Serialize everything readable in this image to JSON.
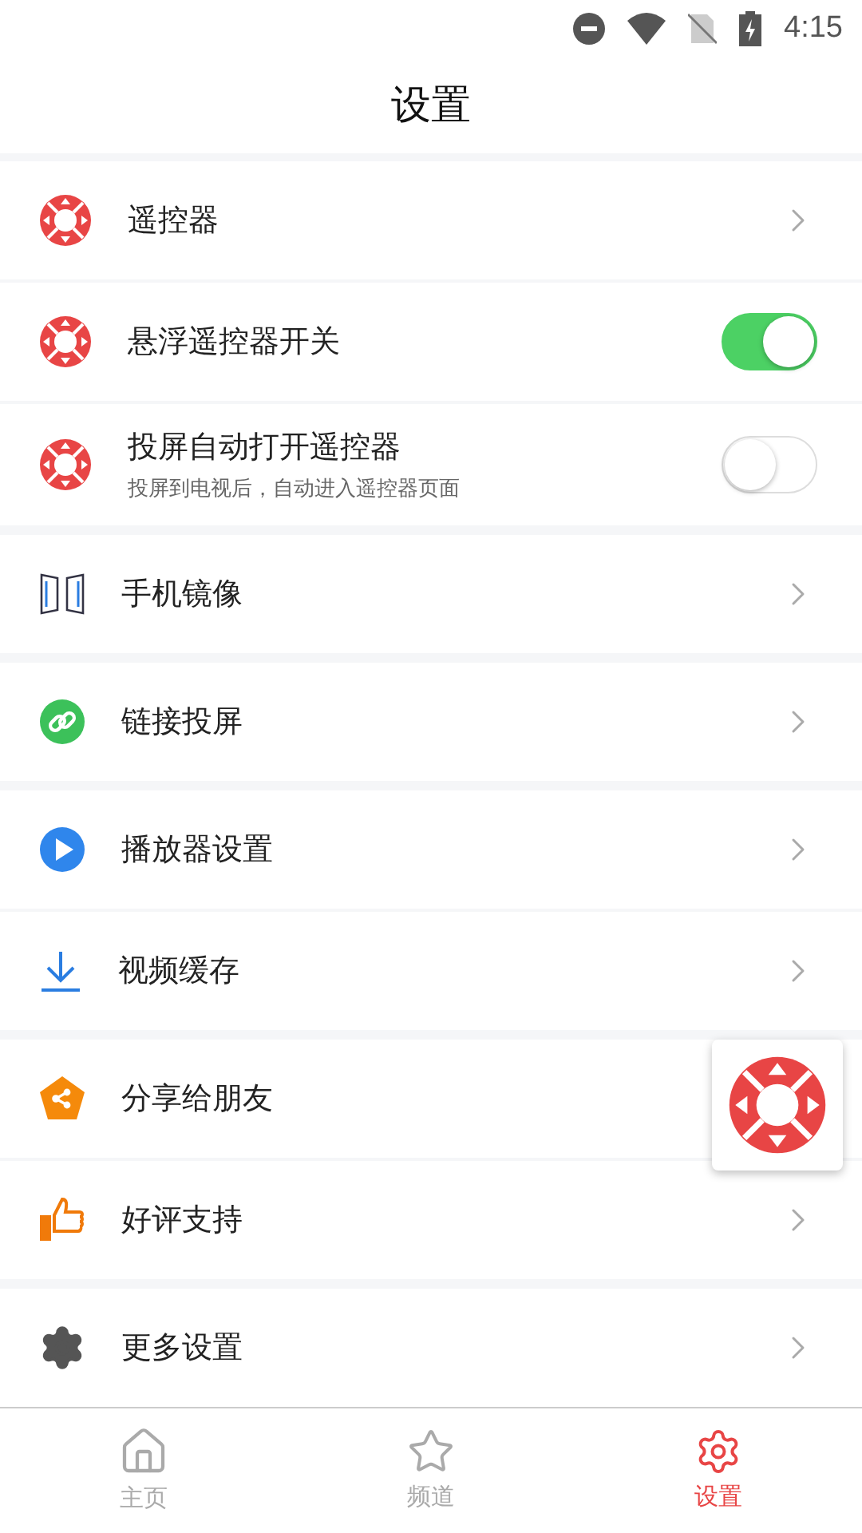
{
  "status_bar": {
    "time": "4:15"
  },
  "header": {
    "title": "设置"
  },
  "groups": [
    {
      "items": [
        {
          "kind": "link",
          "label": "遥控器"
        },
        {
          "kind": "toggle",
          "label": "悬浮遥控器开关",
          "on": true
        },
        {
          "kind": "toggle",
          "label": "投屏自动打开遥控器",
          "subtitle": "投屏到电视后，自动进入遥控器页面",
          "on": false
        }
      ]
    },
    {
      "items": [
        {
          "kind": "link",
          "label": "手机镜像"
        }
      ]
    },
    {
      "items": [
        {
          "kind": "link",
          "label": "链接投屏"
        }
      ]
    },
    {
      "items": [
        {
          "kind": "link",
          "label": "播放器设置"
        },
        {
          "kind": "link",
          "label": "视频缓存"
        }
      ]
    },
    {
      "items": [
        {
          "kind": "plain",
          "label": "分享给朋友"
        },
        {
          "kind": "link",
          "label": "好评支持"
        }
      ]
    },
    {
      "items": [
        {
          "kind": "link",
          "label": "更多设置"
        }
      ]
    }
  ],
  "tab_bar": [
    {
      "label": "主页",
      "selected": false
    },
    {
      "label": "频道",
      "selected": false
    },
    {
      "label": "设置",
      "selected": true
    }
  ]
}
